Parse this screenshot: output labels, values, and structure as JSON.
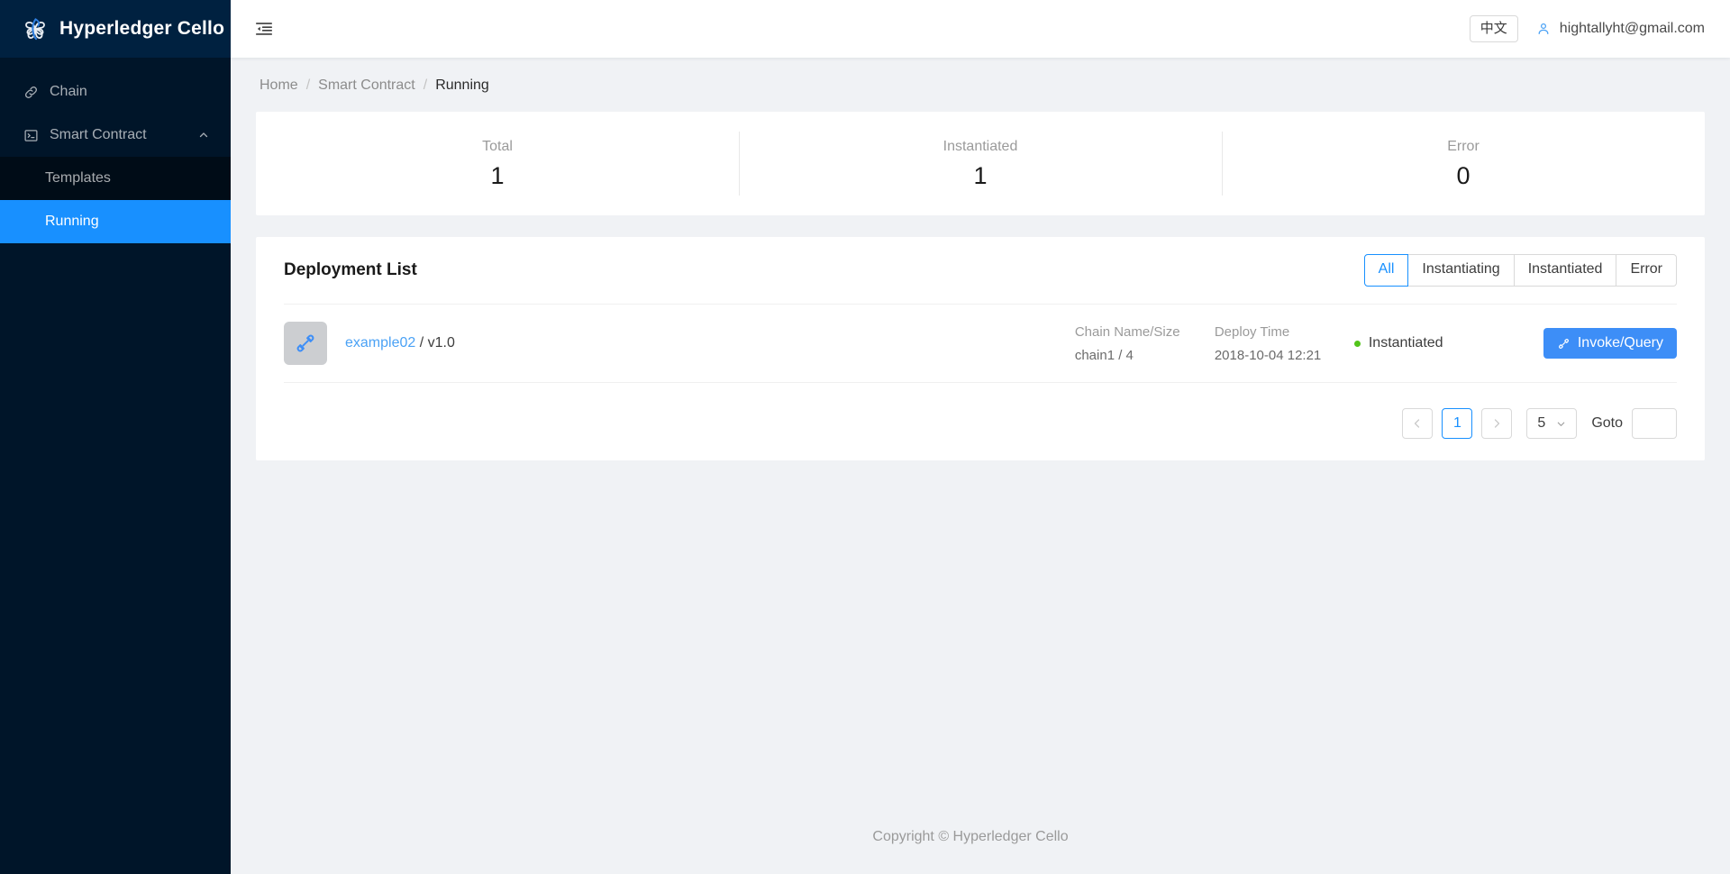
{
  "sidebar": {
    "logo_text": "Hyperledger Cello",
    "logo_icon": "hyperledger-pinwheel-logo",
    "items": [
      {
        "label": "Chain",
        "icon": "link-icon"
      },
      {
        "label": "Smart Contract",
        "icon": "code-terminal-icon",
        "expand_icon": "chevron-up-icon"
      }
    ],
    "submenu": [
      {
        "label": "Templates"
      },
      {
        "label": "Running",
        "active": true
      }
    ]
  },
  "topbar": {
    "fold_icon": "menu-fold-icon",
    "lang_button": "中文",
    "user_icon": "user-icon",
    "user_name": "hightallyht@gmail.com"
  },
  "breadcrumb": {
    "items": [
      "Home",
      "Smart Contract",
      "Running"
    ],
    "separator": "/"
  },
  "stats": [
    {
      "label": "Total",
      "value": "1"
    },
    {
      "label": "Instantiated",
      "value": "1"
    },
    {
      "label": "Error",
      "value": "0"
    }
  ],
  "list": {
    "title": "Deployment List",
    "filters": [
      {
        "label": "All",
        "active": true
      },
      {
        "label": "Instantiating",
        "active": false
      },
      {
        "label": "Instantiated",
        "active": false
      },
      {
        "label": "Error",
        "active": false
      }
    ],
    "rows": [
      {
        "avatar_icon": "api-plug-icon",
        "name": "example02",
        "separator": "/",
        "version": "v1.0",
        "chain_label": "Chain Name/Size",
        "chain_value": "chain1 / 4",
        "deploy_label": "Deploy Time",
        "deploy_value": "2018-10-04 12:21",
        "status": "Instantiated",
        "status_color": "#52c41a",
        "action_label": "Invoke/Query",
        "action_icon": "api-plug-icon"
      }
    ]
  },
  "pagination": {
    "prev_icon": "chevron-left-icon",
    "next_icon": "chevron-right-icon",
    "current_page": "1",
    "page_size": "5",
    "page_size_caret": "chevron-down-icon",
    "goto_label": "Goto",
    "goto_value": ""
  },
  "footer": {
    "text": "Copyright © Hyperledger Cello"
  },
  "colors": {
    "accent": "#1890ff",
    "sidebar_bg": "#001529",
    "sidebar_logo_bg": "#002140",
    "submenu_bg": "#000c17",
    "page_bg": "#f0f2f5",
    "status_green": "#52c41a"
  }
}
